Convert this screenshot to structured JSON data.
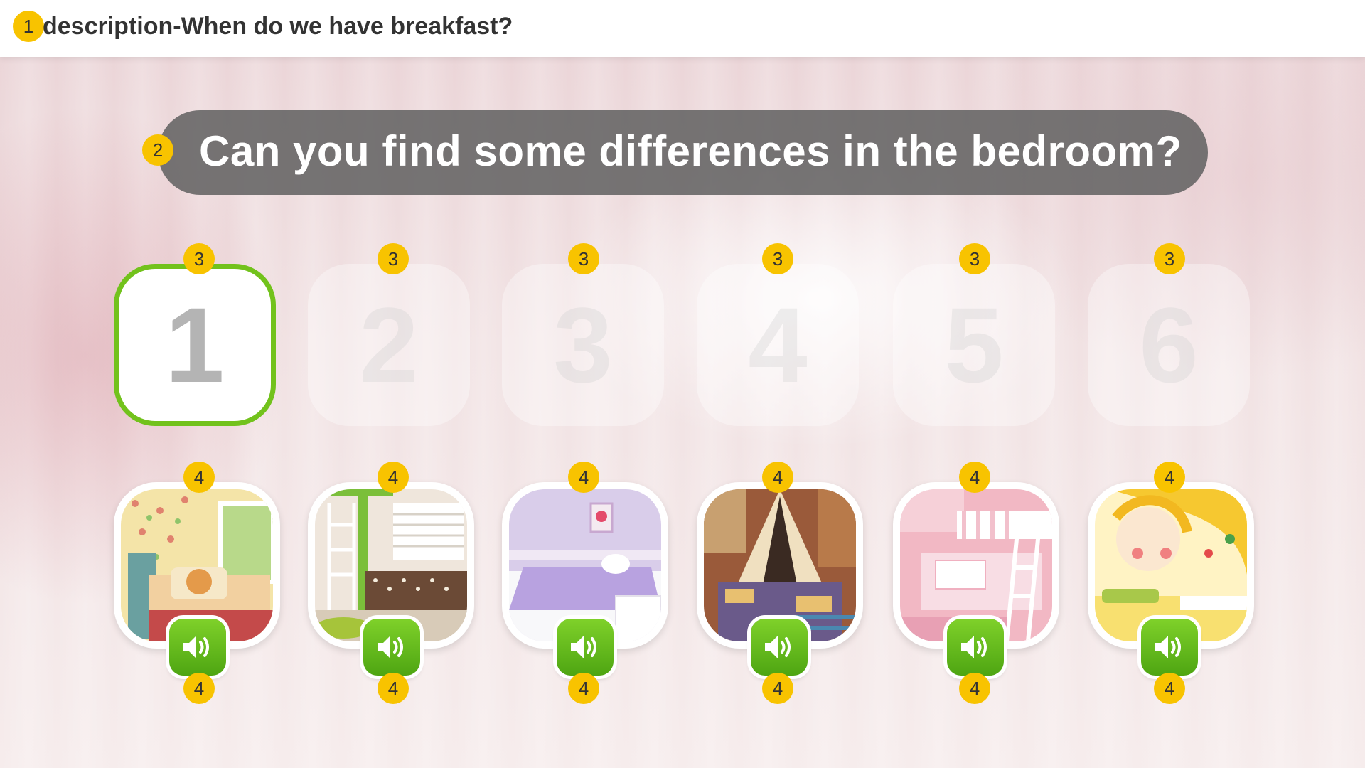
{
  "header": {
    "title": "description-When do we have breakfast?",
    "badge": "1"
  },
  "question": {
    "text": "Can you find some differences in the bedroom?",
    "badge": "2"
  },
  "number_cards": [
    {
      "label": "1",
      "badge": "3",
      "selected": true
    },
    {
      "label": "2",
      "badge": "3",
      "selected": false
    },
    {
      "label": "3",
      "badge": "3",
      "selected": false
    },
    {
      "label": "4",
      "badge": "3",
      "selected": false
    },
    {
      "label": "5",
      "badge": "3",
      "selected": false
    },
    {
      "label": "6",
      "badge": "3",
      "selected": false
    }
  ],
  "picture_cards": [
    {
      "image": "bedroom-green-bed-photo",
      "badge_top": "4",
      "badge_bottom": "4",
      "sound_icon": "speaker-icon"
    },
    {
      "image": "bedroom-loft-ladder-photo",
      "badge_top": "4",
      "badge_bottom": "4",
      "sound_icon": "speaker-icon"
    },
    {
      "image": "bedroom-purple-photo",
      "badge_top": "4",
      "badge_bottom": "4",
      "sound_icon": "speaker-icon"
    },
    {
      "image": "bedroom-tent-bed-photo",
      "badge_top": "4",
      "badge_bottom": "4",
      "sound_icon": "speaker-icon"
    },
    {
      "image": "bedroom-pink-bunk-photo",
      "badge_top": "4",
      "badge_bottom": "4",
      "sound_icon": "speaker-icon"
    },
    {
      "image": "bedroom-yellow-mural-photo",
      "badge_top": "4",
      "badge_bottom": "4",
      "sound_icon": "speaker-icon"
    }
  ],
  "colors": {
    "accent_green": "#72c21c",
    "badge_yellow": "#f8c300",
    "pill_gray": "#5f5f5f"
  }
}
